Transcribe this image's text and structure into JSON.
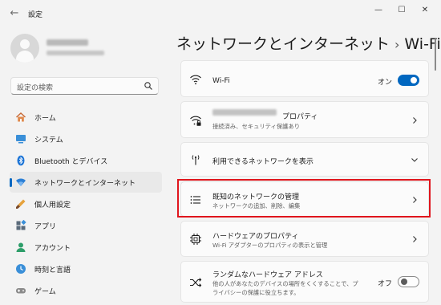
{
  "window": {
    "title": "設定",
    "back_glyph": "←",
    "minimize_glyph": "—",
    "maximize_glyph": "☐",
    "close_glyph": "✕"
  },
  "search": {
    "placeholder": "設定の検索"
  },
  "sidebar": {
    "items": [
      {
        "label": "ホーム",
        "icon": "home-icon"
      },
      {
        "label": "システム",
        "icon": "system-icon"
      },
      {
        "label": "Bluetooth とデバイス",
        "icon": "bluetooth-icon"
      },
      {
        "label": "ネットワークとインターネット",
        "icon": "network-icon",
        "active": true
      },
      {
        "label": "個人用設定",
        "icon": "personalization-icon"
      },
      {
        "label": "アプリ",
        "icon": "apps-icon"
      },
      {
        "label": "アカウント",
        "icon": "account-icon"
      },
      {
        "label": "時刻と言語",
        "icon": "time-language-icon"
      },
      {
        "label": "ゲーム",
        "icon": "gaming-icon"
      }
    ]
  },
  "breadcrumb": {
    "parent": "ネットワークとインターネット",
    "separator": "›",
    "current": "Wi-Fi"
  },
  "cards": {
    "wifi": {
      "title": "Wi-Fi",
      "toggle_label": "オン",
      "toggle_on": true,
      "icon": "wifi-icon"
    },
    "properties": {
      "title_suffix": "プロパティ",
      "subtitle": "接続済み、セキュリティ保護あり",
      "icon": "wifi-lock-icon"
    },
    "available": {
      "title": "利用できるネットワークを表示",
      "icon": "antenna-icon"
    },
    "known": {
      "title": "既知のネットワークの管理",
      "subtitle": "ネットワークの追加、削除、編集",
      "icon": "list-icon"
    },
    "hardware": {
      "title": "ハードウェアのプロパティ",
      "subtitle": "Wi-Fi アダプターのプロパティの表示と管理",
      "icon": "chip-icon"
    },
    "random": {
      "title": "ランダムなハードウェア アドレス",
      "subtitle_line1": "他の人があなたのデバイスの場所をくくすることで、プ",
      "subtitle_line2": "ライバシーの保護に役立ちます。",
      "toggle_label": "オフ",
      "toggle_on": false,
      "icon": "shuffle-icon"
    }
  },
  "colors": {
    "accent": "#0067c0",
    "highlight": "#e0161d",
    "background": "#f3f3f3",
    "card": "#fbfbfb"
  }
}
